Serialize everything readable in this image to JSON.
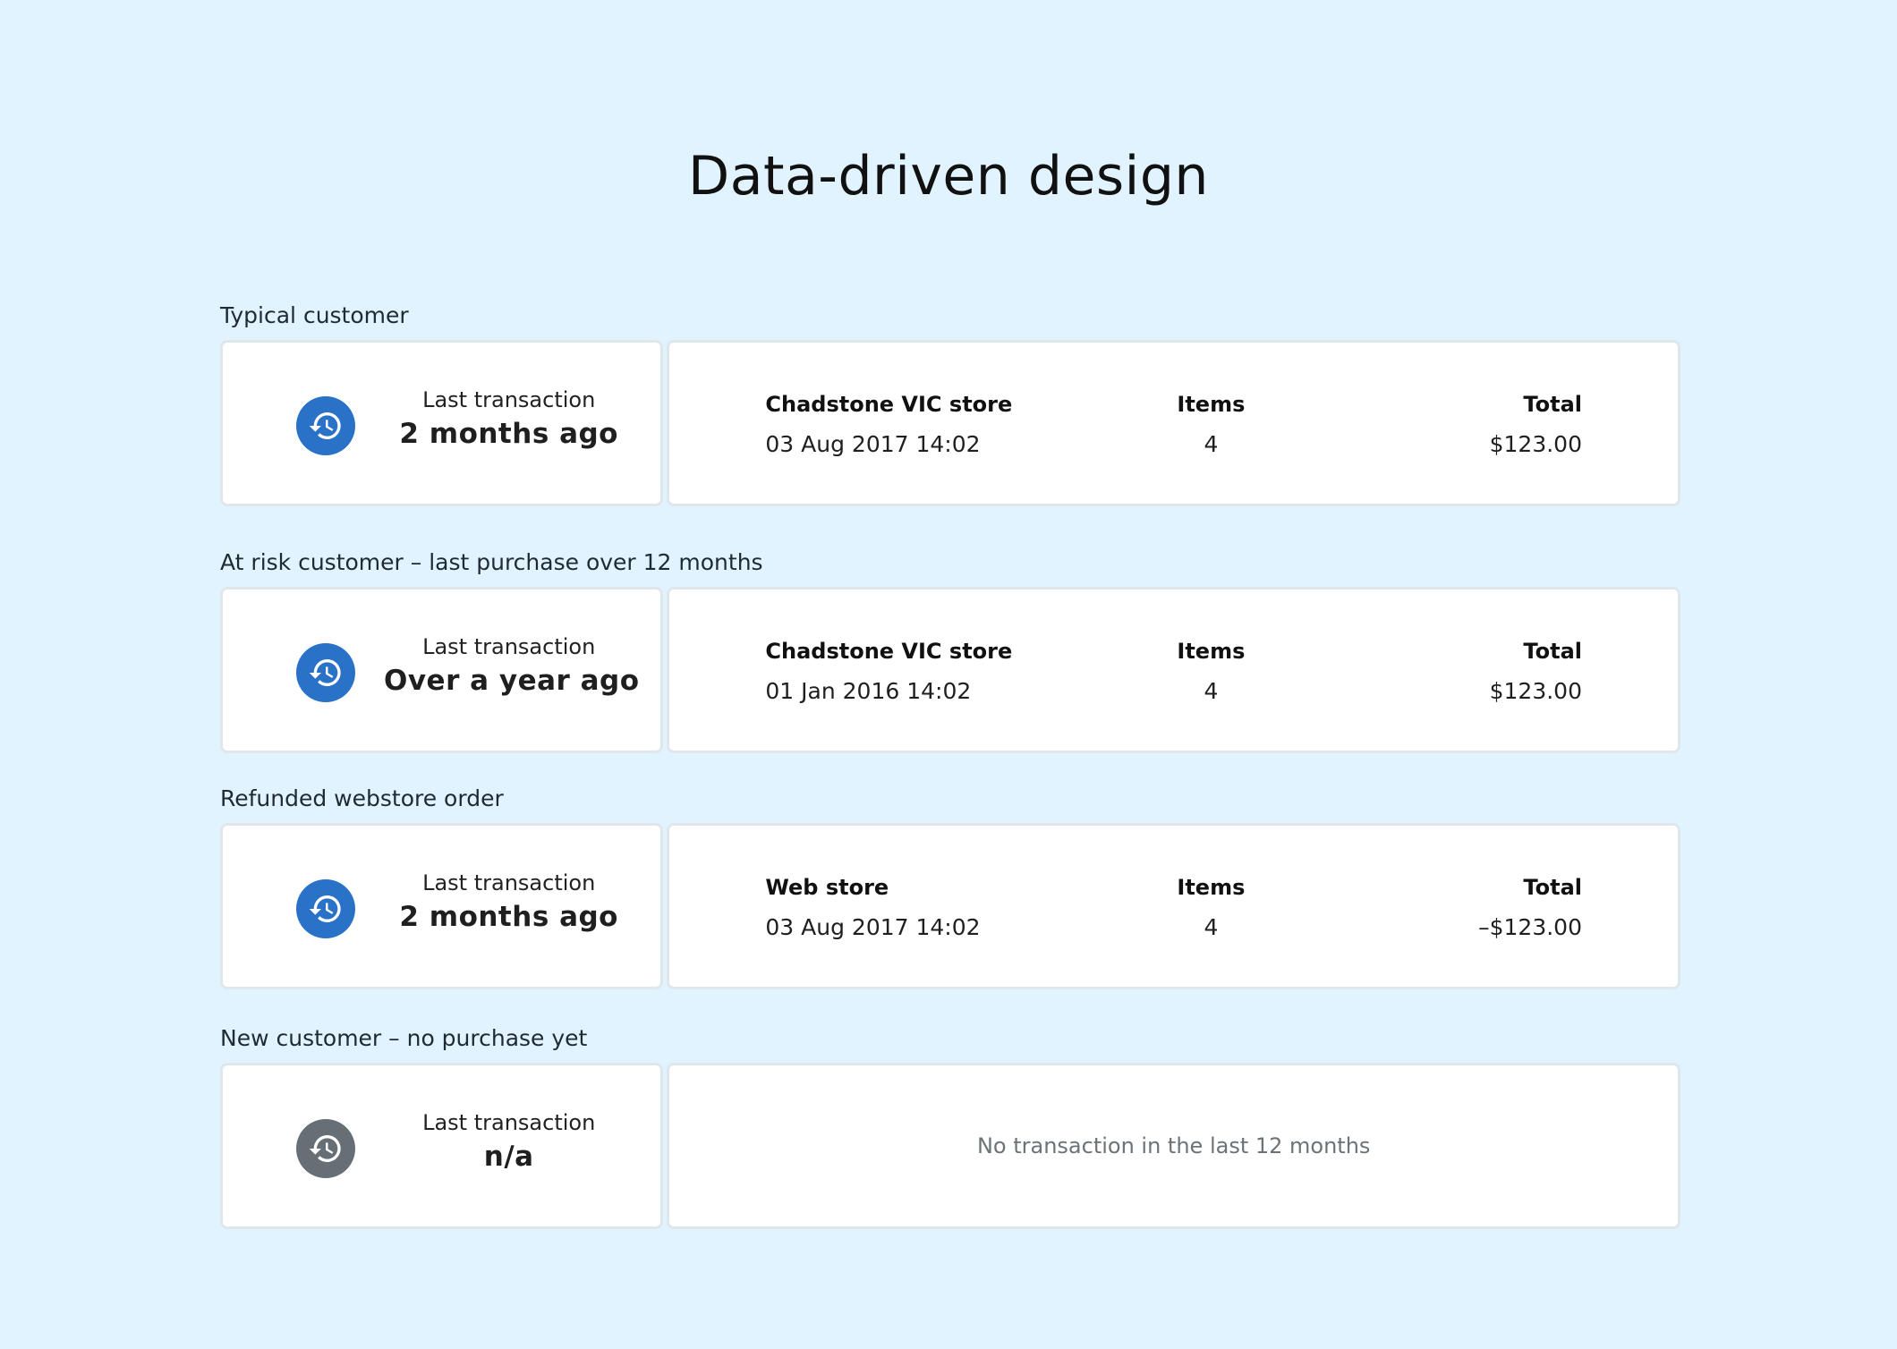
{
  "title": "Data-driven design",
  "sections": [
    {
      "label": "Typical customer",
      "last_label": "Last transaction",
      "last_value": "2 months ago",
      "icon": "history-icon",
      "icon_color": "#2a72c8",
      "store_header": "Chadstone VIC store",
      "date": "03 Aug 2017 14:02",
      "items_header": "Items",
      "items_value": "4",
      "total_header": "Total",
      "total_value": "$123.00"
    },
    {
      "label": "At risk customer – last purchase over 12 months",
      "last_label": "Last transaction",
      "last_value": "Over a year ago",
      "icon": "history-icon",
      "icon_color": "#2a72c8",
      "store_header": "Chadstone VIC store",
      "date": "01 Jan 2016 14:02",
      "items_header": "Items",
      "items_value": "4",
      "total_header": "Total",
      "total_value": "$123.00"
    },
    {
      "label": "Refunded webstore order",
      "last_label": "Last transaction",
      "last_value": "2 months ago",
      "icon": "history-icon",
      "icon_color": "#2a72c8",
      "store_header": "Web store",
      "date": "03 Aug 2017 14:02",
      "items_header": "Items",
      "items_value": "4",
      "total_header": "Total",
      "total_value": "–$123.00"
    },
    {
      "label": "New customer – no purchase yet",
      "last_label": "Last transaction",
      "last_value": "n/a",
      "icon": "history-icon",
      "icon_color": "#666f76",
      "empty_message": "No transaction in the last 12 months"
    }
  ],
  "colors": {
    "background": "#e1f3fe",
    "accent": "#2a72c8",
    "muted_icon": "#666f76",
    "card": "#ffffff"
  }
}
